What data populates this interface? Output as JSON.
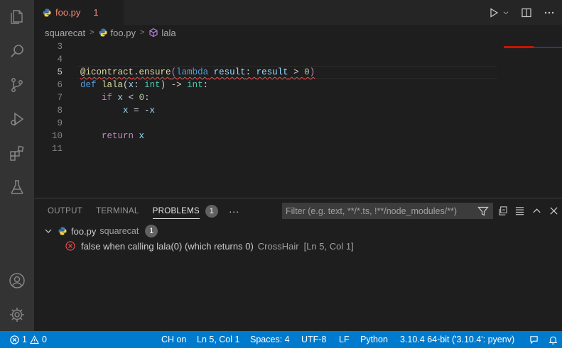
{
  "tab": {
    "file_name": "foo.py",
    "problem_count": "1",
    "close_glyph": "×"
  },
  "breadcrumb": {
    "folder": "squarecat",
    "file": "foo.py",
    "symbol": "lala"
  },
  "editor": {
    "lines": [
      {
        "num": "3"
      },
      {
        "num": "4"
      },
      {
        "num": "5"
      },
      {
        "num": "6"
      },
      {
        "num": "7"
      },
      {
        "num": "8"
      },
      {
        "num": "9"
      },
      {
        "num": "10"
      },
      {
        "num": "11"
      }
    ],
    "code": {
      "l5_at": "@",
      "l5_deco": "icontract",
      "l5_dot": ".",
      "l5_ensure": "ensure",
      "l5_paren": "(",
      "l5_lambda": "lambda",
      "l5_result": "result",
      "l5_colon": ": ",
      "l5_result2": "result",
      "l5_gt": " > ",
      "l5_zero": "0",
      "l5_close": ")",
      "l6_def": "def",
      "l6_name": "lala",
      "l6_open": "(",
      "l6_x": "x",
      "l6_colon": ": ",
      "l6_int": "int",
      "l6_arrow": ") -> ",
      "l6_int2": "int",
      "l6_end": ":",
      "l7_if": "if",
      "l7_x": "x",
      "l7_lt": " < ",
      "l7_zero": "0",
      "l7_end": ":",
      "l8_x": "x",
      "l8_eq": " = -",
      "l8_x2": "x",
      "l10_return": "return",
      "l10_x": "x"
    }
  },
  "panel": {
    "tabs": [
      {
        "label": "OUTPUT"
      },
      {
        "label": "TERMINAL"
      },
      {
        "label": "PROBLEMS",
        "badge": "1"
      }
    ],
    "more": "···",
    "filter_placeholder": "Filter (e.g. text, **/*.ts, !**/node_modules/**)",
    "file_row": {
      "name": "foo.py",
      "dir": "squarecat",
      "count": "1"
    },
    "problem": {
      "message": "false when calling lala(0) (which returns 0)",
      "source": "CrossHair",
      "location": "[Ln 5, Col 1]"
    }
  },
  "statusbar": {
    "errors": "1",
    "warnings": "0",
    "ch": "CH on",
    "position": "Ln 5, Col 1",
    "spaces": "Spaces: 4",
    "encoding": "UTF-8",
    "eol": "LF",
    "language": "Python",
    "interpreter": "3.10.4 64-bit ('3.10.4': pyenv)"
  },
  "colors": {
    "statusbar": "#007acc",
    "error": "#f14c4c",
    "tab_modified": "#f48771",
    "activity": "#333333"
  }
}
